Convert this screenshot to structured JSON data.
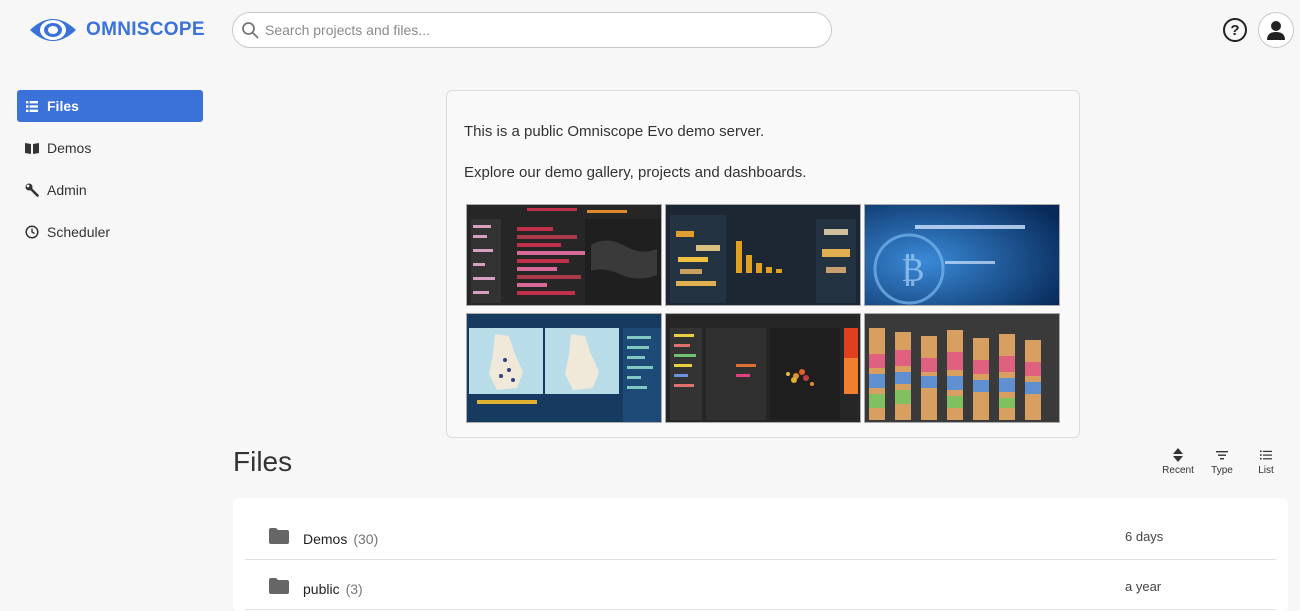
{
  "brand": {
    "name": "OMNISCOPE",
    "color": "#3b72d9"
  },
  "search": {
    "placeholder": "Search projects and files..."
  },
  "header": {
    "help_icon": "help-circle-icon",
    "user_icon": "user-avatar-icon",
    "help_glyph": "?"
  },
  "sidebar": {
    "items": [
      {
        "label": "Files",
        "icon": "list-icon",
        "active": true
      },
      {
        "label": "Demos",
        "icon": "book-icon",
        "active": false
      },
      {
        "label": "Admin",
        "icon": "wrench-icon",
        "active": false
      },
      {
        "label": "Scheduler",
        "icon": "clock-icon",
        "active": false
      }
    ]
  },
  "banner": {
    "line1": "This is a public Omniscope Evo demo server.",
    "line2": "Explore our demo gallery, projects and dashboards.",
    "thumbnails": [
      "dark-dashboard-bars-map",
      "word-cloud-dashboard",
      "bitcoin-blue-dashboard",
      "uk-map-dashboard",
      "dark-table-scatter-dashboard",
      "stacked-area-dashboard"
    ]
  },
  "files": {
    "title": "Files",
    "controls": [
      {
        "label": "Recent",
        "icon": "sort-icon"
      },
      {
        "label": "Type",
        "icon": "filter-icon"
      },
      {
        "label": "List",
        "icon": "list-view-icon"
      }
    ],
    "rows": [
      {
        "name": "Demos",
        "count": "(30)",
        "modified": "6 days"
      },
      {
        "name": "public",
        "count": "(3)",
        "modified": "a year"
      }
    ]
  }
}
